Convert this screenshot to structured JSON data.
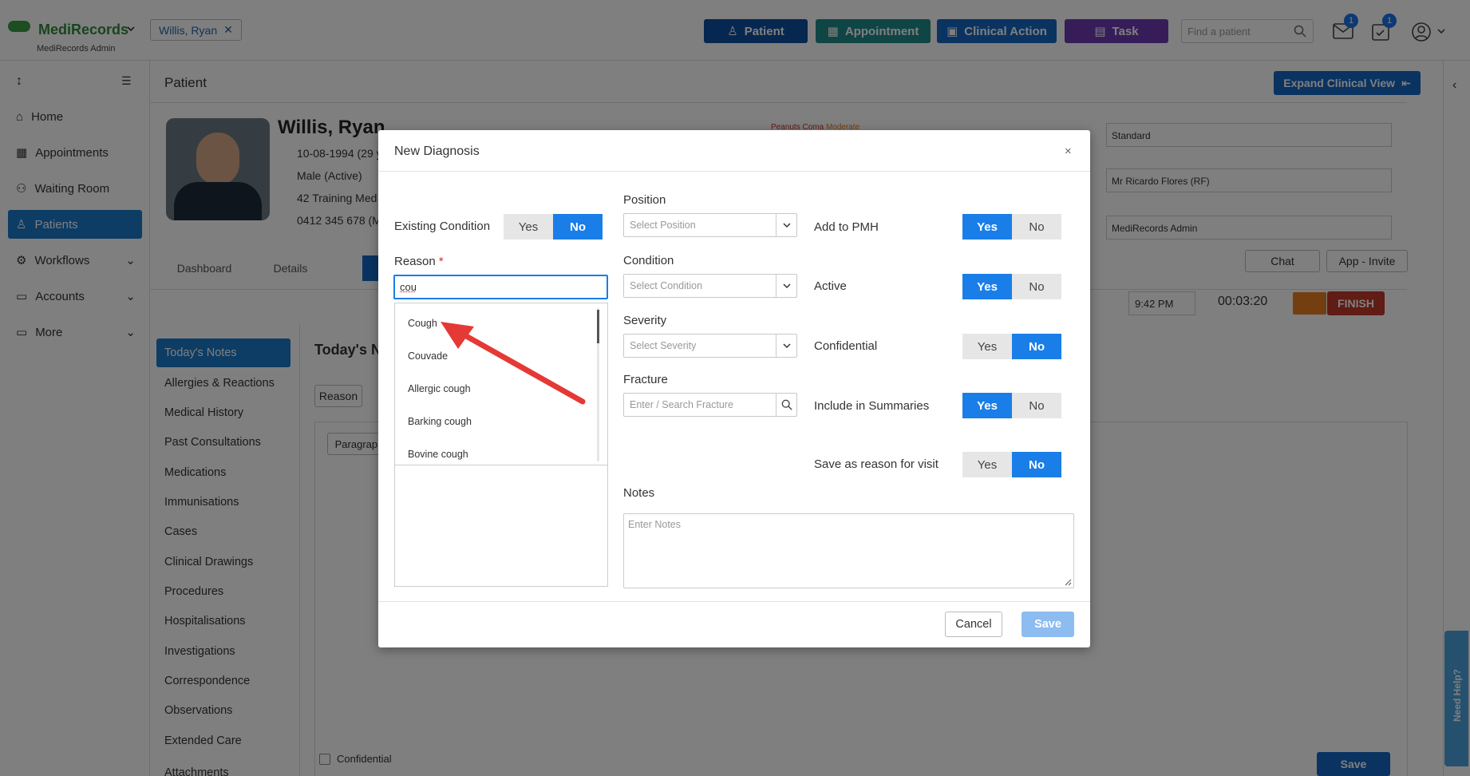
{
  "app": {
    "name": "MediRecords",
    "sub": "MediRecords Admin",
    "patient_tab": "Willis, Ryan"
  },
  "header": {
    "buttons": [
      {
        "label": "Patient",
        "color": "#0d4fa0"
      },
      {
        "label": "Appointment",
        "color": "#1e8a88"
      },
      {
        "label": "Clinical Action",
        "color": "#1467c2"
      },
      {
        "label": "Task",
        "color": "#6c3ab5"
      }
    ],
    "search_placeholder": "Find a patient",
    "mail_count": "1",
    "tasks_count": "1"
  },
  "sidebar": {
    "items": [
      {
        "label": "Home",
        "icon": "home-icon"
      },
      {
        "label": "Appointments",
        "icon": "calendar-icon"
      },
      {
        "label": "Waiting Room",
        "icon": "people-icon"
      },
      {
        "label": "Patients",
        "icon": "patient-icon",
        "active": true
      },
      {
        "label": "Workflows",
        "icon": "workflow-icon"
      },
      {
        "label": "Accounts",
        "icon": "folder-icon"
      },
      {
        "label": "More",
        "icon": "more-folder-icon"
      }
    ]
  },
  "page": {
    "title": "Patient",
    "expand_btn": "Expand Clinical View"
  },
  "patient": {
    "name": "Willis, Ryan",
    "dob": "10-08-1994 (29 y",
    "gender": "Male (Active)",
    "address": "42 Training Med",
    "phone": "0412 345 678 (M",
    "alert": "Peanuts Coma",
    "alert_level": "Moderate"
  },
  "tabs": [
    "Dashboard",
    "Details"
  ],
  "right_fields": {
    "standard": "Standard",
    "doctor": "Mr Ricardo Flores (RF)",
    "admin": "MediRecords Admin",
    "chat": "Chat",
    "invite": "App - Invite",
    "time": "9:42 PM",
    "timer": "00:03:20",
    "finish": "FINISH"
  },
  "menu2": [
    "Today's Notes",
    "Allergies & Reactions",
    "Medical History",
    "Past Consultations",
    "Medications",
    "Immunisations",
    "Cases",
    "Clinical Drawings",
    "Procedures",
    "Hospitalisations",
    "Investigations",
    "Correspondence",
    "Observations",
    "Extended Care",
    "Attachments"
  ],
  "notes_panel": {
    "title": "Today's N",
    "reason_btn": "Reason",
    "paragraph": "Paragraph",
    "confidential": "Confidential",
    "save": "Save"
  },
  "modal": {
    "title": "New Diagnosis",
    "existing_label": "Existing Condition",
    "yes": "Yes",
    "no": "No",
    "reason_label": "Reason",
    "required_mark": "*",
    "reason_value": "cou",
    "suggestions": [
      "Cough",
      "Couvade",
      "Allergic cough",
      "Barking cough",
      "Bovine cough"
    ],
    "position_label": "Position",
    "position_placeholder": "Select Position",
    "condition_label": "Condition",
    "condition_placeholder": "Select Condition",
    "severity_label": "Severity",
    "severity_placeholder": "Select Severity",
    "fracture_label": "Fracture",
    "fracture_placeholder": "Enter / Search Fracture",
    "pmh_label": "Add to PMH",
    "active_label": "Active",
    "confidential_label": "Confidential",
    "summaries_label": "Include in Summaries",
    "reason_visit_label": "Save as reason for visit",
    "notes_label": "Notes",
    "notes_placeholder": "Enter Notes",
    "cancel": "Cancel",
    "save": "Save"
  },
  "help_tab": "Need Help?",
  "colors": {
    "accent": "#1a7ee8",
    "arrow": "#e53935",
    "finish": "#c0392b",
    "pause": "#e67e22"
  }
}
